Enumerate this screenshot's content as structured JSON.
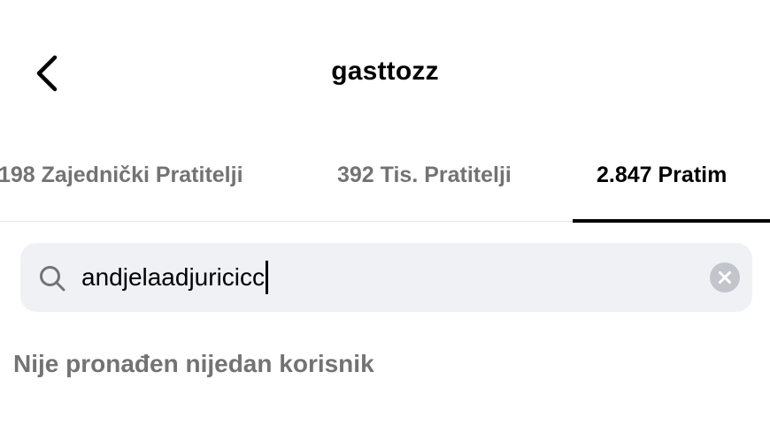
{
  "header": {
    "title": "gasttozz",
    "back_icon": "chevron-left-icon"
  },
  "tabs": [
    {
      "label": "198 Zajednički Pratitelji",
      "active": false
    },
    {
      "label": "392 Tis. Pratitelji",
      "active": false
    },
    {
      "label": "2.847 Pratim",
      "active": true
    }
  ],
  "search": {
    "value": "andjelaadjuricicc",
    "icon": "search-icon",
    "clear_icon": "clear-icon"
  },
  "results": {
    "empty_message": "Nije pronađen nijedan korisnik"
  },
  "colors": {
    "text_primary": "#000000",
    "text_secondary": "#737373",
    "search_background": "#eff1f5",
    "clear_button": "#c2c5cb"
  }
}
